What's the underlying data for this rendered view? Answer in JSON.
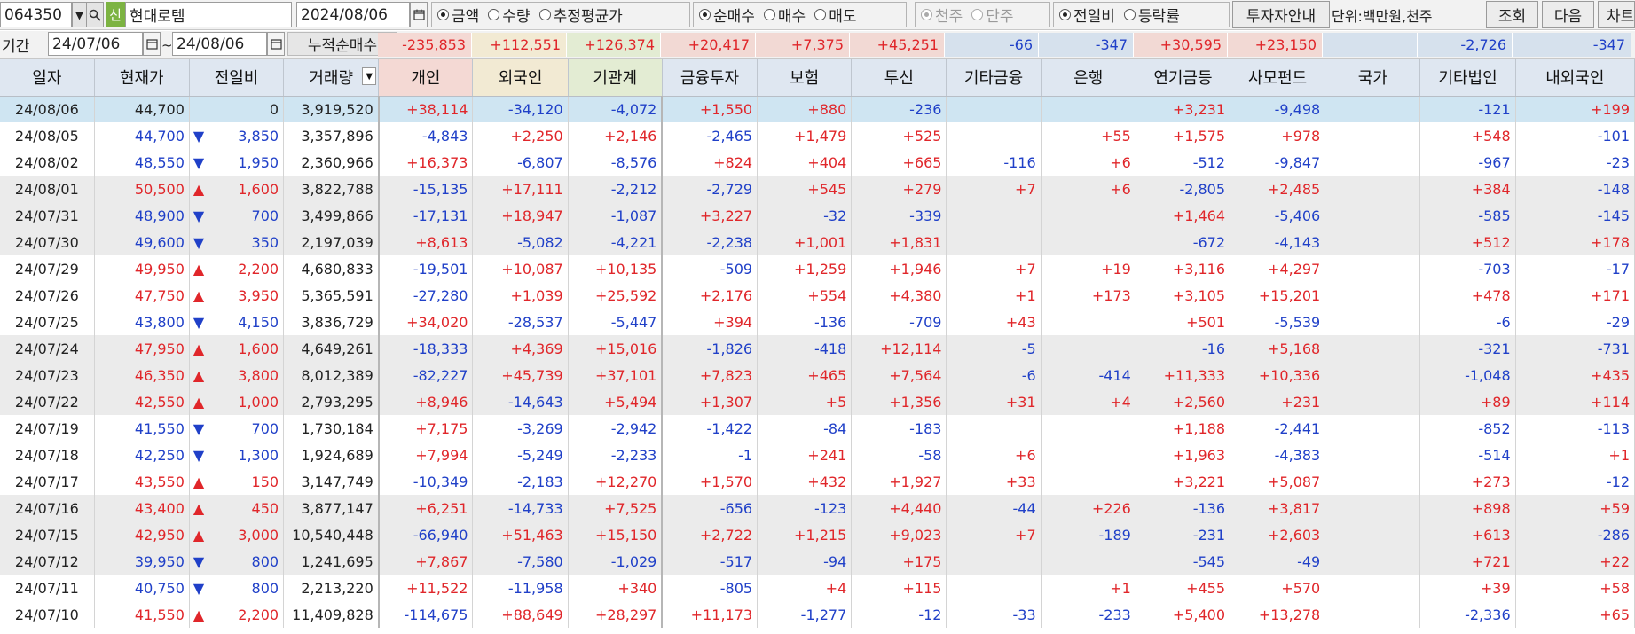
{
  "toolbar": {
    "stock_code": "064350",
    "new_badge": "신",
    "stock_name": "현대로템",
    "date": "2024/08/06",
    "radio_amount_type": [
      {
        "label": "금액",
        "checked": true
      },
      {
        "label": "수량",
        "checked": false
      },
      {
        "label": "추정평균가",
        "checked": false
      }
    ],
    "radio_trade_type": [
      {
        "label": "순매수",
        "checked": true
      },
      {
        "label": "매수",
        "checked": false
      },
      {
        "label": "매도",
        "checked": false
      }
    ],
    "radio_unit": [
      {
        "label": "천주",
        "checked": true,
        "disabled": true
      },
      {
        "label": "단주",
        "checked": false,
        "disabled": true
      }
    ],
    "radio_compare": [
      {
        "label": "전일비",
        "checked": true
      },
      {
        "label": "등락률",
        "checked": false
      }
    ],
    "investor_guide_button": "투자자안내",
    "unit_text": "단위:백만원,천주",
    "query_button": "조회",
    "next_button": "다음",
    "chart_button": "차트"
  },
  "daterow": {
    "period_label": "기간",
    "start_date": "24/07/06",
    "tilde": "~",
    "end_date": "24/08/06",
    "cumulative_label": "누적순매수",
    "cumulative": [
      {
        "value": "-235,853",
        "color": "red",
        "bg": "#f4d9d4"
      },
      {
        "value": "+112,551",
        "color": "red",
        "bg": "#f2ead3"
      },
      {
        "value": "+126,374",
        "color": "red",
        "bg": "#e3ecd3"
      },
      {
        "value": "+20,417",
        "color": "red",
        "bg": "#f2d9d4"
      },
      {
        "value": "+7,375",
        "color": "red",
        "bg": "#f2d9d4"
      },
      {
        "value": "+45,251",
        "color": "red",
        "bg": "#f2d9d4"
      },
      {
        "value": "-66",
        "color": "blue",
        "bg": "#d6e1ed"
      },
      {
        "value": "-347",
        "color": "blue",
        "bg": "#d6e1ed"
      },
      {
        "value": "+30,595",
        "color": "red",
        "bg": "#f2d9d4"
      },
      {
        "value": "+23,150",
        "color": "red",
        "bg": "#f2d9d4"
      },
      {
        "value": "",
        "color": "red",
        "bg": "#d6e1ed"
      },
      {
        "value": "-2,726",
        "color": "blue",
        "bg": "#d6e1ed"
      },
      {
        "value": "-347",
        "color": "blue",
        "bg": "#d6e1ed"
      }
    ]
  },
  "table": {
    "headers": [
      "일자",
      "현재가",
      "전일비",
      "거래량",
      "개인",
      "외국인",
      "기관계",
      "금융투자",
      "보험",
      "투신",
      "기타금융",
      "은행",
      "연기금등",
      "사모펀드",
      "국가",
      "기타법인",
      "내외국인"
    ],
    "rows": [
      {
        "style": "sel",
        "date": "24/08/06",
        "price": "44,700",
        "pc": "black",
        "arrow": "",
        "dir": "",
        "change": "0",
        "volume": "3,919,520",
        "cells": [
          "+38,114",
          "-34,120",
          "-4,072",
          "+1,550",
          "+880",
          "-236",
          "",
          "",
          "+3,231",
          "-9,498",
          "",
          "-121",
          "+199"
        ]
      },
      {
        "style": "white",
        "date": "24/08/05",
        "price": "44,700",
        "pc": "blue",
        "arrow": "▼",
        "dir": "down",
        "change": "3,850",
        "volume": "3,357,896",
        "cells": [
          "-4,843",
          "+2,250",
          "+2,146",
          "-2,465",
          "+1,479",
          "+525",
          "",
          "+55",
          "+1,575",
          "+978",
          "",
          "+548",
          "-101"
        ]
      },
      {
        "style": "white",
        "date": "24/08/02",
        "price": "48,550",
        "pc": "blue",
        "arrow": "▼",
        "dir": "down",
        "change": "1,950",
        "volume": "2,360,966",
        "cells": [
          "+16,373",
          "-6,807",
          "-8,576",
          "+824",
          "+404",
          "+665",
          "-116",
          "+6",
          "-512",
          "-9,847",
          "",
          "-967",
          "-23"
        ]
      },
      {
        "style": "gray",
        "date": "24/08/01",
        "price": "50,500",
        "pc": "red",
        "arrow": "▲",
        "dir": "up",
        "change": "1,600",
        "volume": "3,822,788",
        "cells": [
          "-15,135",
          "+17,111",
          "-2,212",
          "-2,729",
          "+545",
          "+279",
          "+7",
          "+6",
          "-2,805",
          "+2,485",
          "",
          "+384",
          "-148"
        ]
      },
      {
        "style": "gray",
        "date": "24/07/31",
        "price": "48,900",
        "pc": "blue",
        "arrow": "▼",
        "dir": "down",
        "change": "700",
        "volume": "3,499,866",
        "cells": [
          "-17,131",
          "+18,947",
          "-1,087",
          "+3,227",
          "-32",
          "-339",
          "",
          "",
          "+1,464",
          "-5,406",
          "",
          "-585",
          "-145"
        ]
      },
      {
        "style": "gray",
        "date": "24/07/30",
        "price": "49,600",
        "pc": "blue",
        "arrow": "▼",
        "dir": "down",
        "change": "350",
        "volume": "2,197,039",
        "cells": [
          "+8,613",
          "-5,082",
          "-4,221",
          "-2,238",
          "+1,001",
          "+1,831",
          "",
          "",
          "-672",
          "-4,143",
          "",
          "+512",
          "+178"
        ]
      },
      {
        "style": "white",
        "date": "24/07/29",
        "price": "49,950",
        "pc": "red",
        "arrow": "▲",
        "dir": "up",
        "change": "2,200",
        "volume": "4,680,833",
        "cells": [
          "-19,501",
          "+10,087",
          "+10,135",
          "-509",
          "+1,259",
          "+1,946",
          "+7",
          "+19",
          "+3,116",
          "+4,297",
          "",
          "-703",
          "-17"
        ]
      },
      {
        "style": "white",
        "date": "24/07/26",
        "price": "47,750",
        "pc": "red",
        "arrow": "▲",
        "dir": "up",
        "change": "3,950",
        "volume": "5,365,591",
        "cells": [
          "-27,280",
          "+1,039",
          "+25,592",
          "+2,176",
          "+554",
          "+4,380",
          "+1",
          "+173",
          "+3,105",
          "+15,201",
          "",
          "+478",
          "+171"
        ]
      },
      {
        "style": "white",
        "date": "24/07/25",
        "price": "43,800",
        "pc": "blue",
        "arrow": "▼",
        "dir": "down",
        "change": "4,150",
        "volume": "3,836,729",
        "cells": [
          "+34,020",
          "-28,537",
          "-5,447",
          "+394",
          "-136",
          "-709",
          "+43",
          "",
          "+501",
          "-5,539",
          "",
          "-6",
          "-29"
        ]
      },
      {
        "style": "gray",
        "date": "24/07/24",
        "price": "47,950",
        "pc": "red",
        "arrow": "▲",
        "dir": "up",
        "change": "1,600",
        "volume": "4,649,261",
        "cells": [
          "-18,333",
          "+4,369",
          "+15,016",
          "-1,826",
          "-418",
          "+12,114",
          "-5",
          "",
          "-16",
          "+5,168",
          "",
          "-321",
          "-731"
        ]
      },
      {
        "style": "gray",
        "date": "24/07/23",
        "price": "46,350",
        "pc": "red",
        "arrow": "▲",
        "dir": "up",
        "change": "3,800",
        "volume": "8,012,389",
        "cells": [
          "-82,227",
          "+45,739",
          "+37,101",
          "+7,823",
          "+465",
          "+7,564",
          "-6",
          "-414",
          "+11,333",
          "+10,336",
          "",
          "-1,048",
          "+435"
        ]
      },
      {
        "style": "gray",
        "date": "24/07/22",
        "price": "42,550",
        "pc": "red",
        "arrow": "▲",
        "dir": "up",
        "change": "1,000",
        "volume": "2,793,295",
        "cells": [
          "+8,946",
          "-14,643",
          "+5,494",
          "+1,307",
          "+5",
          "+1,356",
          "+31",
          "+4",
          "+2,560",
          "+231",
          "",
          "+89",
          "+114"
        ]
      },
      {
        "style": "white",
        "date": "24/07/19",
        "price": "41,550",
        "pc": "blue",
        "arrow": "▼",
        "dir": "down",
        "change": "700",
        "volume": "1,730,184",
        "cells": [
          "+7,175",
          "-3,269",
          "-2,942",
          "-1,422",
          "-84",
          "-183",
          "",
          "",
          "+1,188",
          "-2,441",
          "",
          "-852",
          "-113"
        ]
      },
      {
        "style": "white",
        "date": "24/07/18",
        "price": "42,250",
        "pc": "blue",
        "arrow": "▼",
        "dir": "down",
        "change": "1,300",
        "volume": "1,924,689",
        "cells": [
          "+7,994",
          "-5,249",
          "-2,233",
          "-1",
          "+241",
          "-58",
          "+6",
          "",
          "+1,963",
          "-4,383",
          "",
          "-514",
          "+1"
        ]
      },
      {
        "style": "white",
        "date": "24/07/17",
        "price": "43,550",
        "pc": "red",
        "arrow": "▲",
        "dir": "up",
        "change": "150",
        "volume": "3,147,749",
        "cells": [
          "-10,349",
          "-2,183",
          "+12,270",
          "+1,570",
          "+432",
          "+1,927",
          "+33",
          "",
          "+3,221",
          "+5,087",
          "",
          "+273",
          "-12"
        ]
      },
      {
        "style": "gray",
        "date": "24/07/16",
        "price": "43,400",
        "pc": "red",
        "arrow": "▲",
        "dir": "up",
        "change": "450",
        "volume": "3,877,147",
        "cells": [
          "+6,251",
          "-14,733",
          "+7,525",
          "-656",
          "-123",
          "+4,440",
          "-44",
          "+226",
          "-136",
          "+3,817",
          "",
          "+898",
          "+59"
        ]
      },
      {
        "style": "gray",
        "date": "24/07/15",
        "price": "42,950",
        "pc": "red",
        "arrow": "▲",
        "dir": "up",
        "change": "3,000",
        "volume": "10,540,448",
        "cells": [
          "-66,940",
          "+51,463",
          "+15,150",
          "+2,722",
          "+1,215",
          "+9,023",
          "+7",
          "-189",
          "-231",
          "+2,603",
          "",
          "+613",
          "-286"
        ]
      },
      {
        "style": "gray",
        "date": "24/07/12",
        "price": "39,950",
        "pc": "blue",
        "arrow": "▼",
        "dir": "down",
        "change": "800",
        "volume": "1,241,695",
        "cells": [
          "+7,867",
          "-7,580",
          "-1,029",
          "-517",
          "-94",
          "+175",
          "",
          "",
          "-545",
          "-49",
          "",
          "+721",
          "+22"
        ]
      },
      {
        "style": "white",
        "date": "24/07/11",
        "price": "40,750",
        "pc": "blue",
        "arrow": "▼",
        "dir": "down",
        "change": "800",
        "volume": "2,213,220",
        "cells": [
          "+11,522",
          "-11,958",
          "+340",
          "-805",
          "+4",
          "+115",
          "",
          "+1",
          "+455",
          "+570",
          "",
          "+39",
          "+58"
        ]
      },
      {
        "style": "white",
        "date": "24/07/10",
        "price": "41,550",
        "pc": "red",
        "arrow": "▲",
        "dir": "up",
        "change": "2,200",
        "volume": "11,409,828",
        "cells": [
          "-114,675",
          "+88,649",
          "+28,297",
          "+11,173",
          "-1,277",
          "-12",
          "-33",
          "-233",
          "+5,400",
          "+13,278",
          "",
          "-2,336",
          "+65"
        ]
      }
    ]
  },
  "colors": {
    "positive": "#e0262a",
    "negative": "#2040c8",
    "selected_row": "#cfe5f2",
    "shaded_row": "#ebebeb",
    "header_bg": "#dfe7f1",
    "person_header": "#f4d9d4",
    "foreign_header": "#f2ead3",
    "institution_header": "#e3ecd3",
    "new_badge_bg": "#7cb342"
  }
}
